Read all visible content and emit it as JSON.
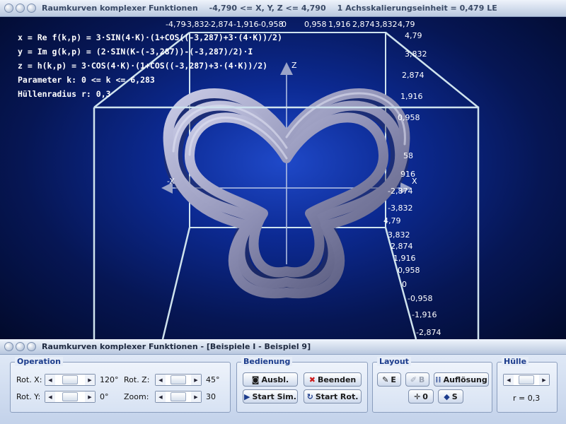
{
  "title_top": {
    "app": "Raumkurven komplexer Funktionen",
    "range": "-4,790 <= X, Y, Z <= 4,790",
    "scale": "1 Achsskalierungseinheit = 0,479 LE"
  },
  "formulas": [
    "x = Re f(k,p) = 3·SIN(4·K)·(1+COS((-3,287)+3·(4·K))/2)",
    "y = Im g(k,p) = (2·SIN(K-(-3,287))-(-3,287)/2)·I",
    "z = h(k,p) = 3·COS(4·K)·(1+COS((-3,287)+3·(4·K))/2)",
    "Parameter k: 0 <= k <= 6,283",
    "Hüllenradius r: 0,3"
  ],
  "axes": {
    "x": "X",
    "neg_x": "-X",
    "z": "Z",
    "y": "Y",
    "top_ticks": [
      "-4,79",
      "-3,832",
      "-2,874",
      "-1,916",
      "-0,958",
      "0",
      "0,958",
      "1,916",
      "2,874",
      "3,832",
      "4,79"
    ],
    "right_ticks_a": [
      "4,79",
      "3,832",
      "2,874",
      "1,916",
      "0,958"
    ],
    "right_ticks_b": [
      "58",
      "916",
      "-2,874",
      "-3,832",
      "4,79"
    ],
    "right_ticks_c": [
      "3,832",
      "2,874",
      "1,916",
      "0,958",
      "0",
      "-0,958",
      "-1,916",
      "-2,874"
    ]
  },
  "title_mid": "Raumkurven komplexer Funktionen - [Beispiele I - Beispiel 9]",
  "operation": {
    "title": "Operation",
    "rot_x_label": "Rot. X:",
    "rot_x_value": "120°",
    "rot_y_label": "Rot. Y:",
    "rot_y_value": "0°",
    "rot_z_label": "Rot. Z:",
    "rot_z_value": "45°",
    "zoom_label": "Zoom:",
    "zoom_value": "30"
  },
  "bedienung": {
    "title": "Bedienung",
    "ausbl": "Ausbl.",
    "beenden": "Beenden",
    "start_sim": "Start Sim.",
    "start_rot": "Start Rot."
  },
  "layout": {
    "title": "Layout",
    "e": "E",
    "b": "B",
    "aufloesung": "Auflösung",
    "zero": "0",
    "s": "S"
  },
  "huelle": {
    "title": "Hülle",
    "value": "r = 0,3"
  },
  "colors": {
    "tube": "#8d8fb4",
    "box_lines": "#cfe3ee"
  }
}
